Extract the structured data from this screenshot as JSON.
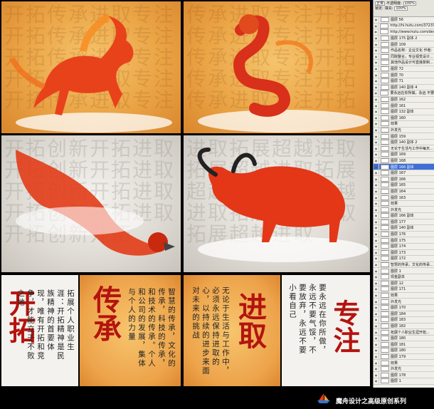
{
  "artworks": [
    {
      "subject": "horse",
      "bg_chars": "开拓传承进取专注开拓传承进取专注开拓传承进取专注开拓传承进取专注开拓传承进取专注"
    },
    {
      "subject": "dragon",
      "bg_chars": "传承进取专注开拓传承进取专注开拓传承进取专注开拓传承进取专注开拓传承进取专注开拓"
    },
    {
      "subject": "eagle",
      "bg_chars": "开拓创新开拓进取开拓创新开拓进取开拓创新开拓进取开拓创新开拓进取开拓创新开拓"
    },
    {
      "subject": "bull",
      "bg_chars": "进取拓展超越进取拓展超越进取拓展超越进取拓展超越进取拓展超越进取拓展超越进取"
    }
  ],
  "posters": [
    {
      "title": "开拓",
      "text": "拓展个人职业生涯：开拓精神是民族精神的首要体现，唯有开拓和竞争，才能立于不败之地"
    },
    {
      "title": "传承",
      "text": "智慧的传承，文化的传承，科技的传承，和技术的传承。个人和公司的发展，集体与个人的力量"
    },
    {
      "title": "进取",
      "text": "无论于生活与工作中，必须永远保持进取的心，以持续的进步来面对未来的挑战"
    },
    {
      "title": "专注",
      "text": "要永远在你所做，永远不要气馁，不要放弃，永远不要小看自己"
    }
  ],
  "layers_panel": {
    "blend_mode": "正常",
    "opacity_label": "不透明度:",
    "opacity_value": "100%",
    "fill_label": "填充:",
    "fill_value": "100%",
    "lock_label": "锁定:",
    "layers": [
      {
        "name": "图层 56",
        "visible": true
      },
      {
        "name": "http://hi.hutu.com/37237...",
        "visible": true
      },
      {
        "name": "http://www.hutu.com/des...",
        "visible": true
      },
      {
        "name": "图层 175 副本 2",
        "visible": true
      },
      {
        "name": "图层 109",
        "visible": true
      },
      {
        "name": "作品名称：企业文化 作者：",
        "visible": true
      },
      {
        "name": "同院整合，专业视觉设计...",
        "visible": true
      },
      {
        "name": "其他作品设计可直接复制...",
        "visible": true
      },
      {
        "name": "图层 72",
        "visible": true
      },
      {
        "name": "图层 70",
        "visible": true
      },
      {
        "name": "图层 71",
        "visible": true
      },
      {
        "name": "图层 140 副本 4",
        "visible": true
      },
      {
        "name": "要永远在你所做，永远 不要...",
        "visible": true
      },
      {
        "name": "图层 162",
        "visible": true
      },
      {
        "name": "图层 161",
        "visible": true
      },
      {
        "name": "图层 132 副本",
        "visible": true
      },
      {
        "name": "图层 160",
        "visible": true
      },
      {
        "name": "效果",
        "visible": true
      },
      {
        "name": "外发光",
        "visible": true
      },
      {
        "name": "图层 159",
        "visible": true
      },
      {
        "name": "图层 140 副本 2",
        "visible": true
      },
      {
        "name": "无论于生活与工作中每天...",
        "visible": true
      },
      {
        "name": "图层 169",
        "visible": true
      },
      {
        "name": "图层 168",
        "visible": true
      },
      {
        "name": "图层 166 副本",
        "visible": true,
        "selected": true
      },
      {
        "name": "图层 167",
        "visible": true
      },
      {
        "name": "图层 166",
        "visible": true
      },
      {
        "name": "图层 165",
        "visible": true
      },
      {
        "name": "图层 164",
        "visible": true
      },
      {
        "name": "图层 163",
        "visible": true
      },
      {
        "name": "效果",
        "visible": true
      },
      {
        "name": "外发光",
        "visible": true
      },
      {
        "name": "图层 166 副本",
        "visible": true
      },
      {
        "name": "图层 177",
        "visible": true
      },
      {
        "name": "图层 140 副本",
        "visible": true
      },
      {
        "name": "图层 176",
        "visible": true
      },
      {
        "name": "图层 175",
        "visible": true
      },
      {
        "name": "图层 174",
        "visible": true
      },
      {
        "name": "图层 173",
        "visible": true
      },
      {
        "name": "图层 172",
        "visible": true
      },
      {
        "name": "智慧的传承，文化的传承...",
        "visible": true
      },
      {
        "name": "图层 1",
        "visible": true
      },
      {
        "name": "现金副本",
        "visible": true
      },
      {
        "name": "图层 12",
        "visible": true
      },
      {
        "name": "图层 171",
        "visible": true
      },
      {
        "name": "效果",
        "visible": true
      },
      {
        "name": "外发光",
        "visible": true
      },
      {
        "name": "图层 170",
        "visible": true
      },
      {
        "name": "图层 184",
        "visible": true
      },
      {
        "name": "图层 183",
        "visible": true
      },
      {
        "name": "图层 182",
        "visible": true
      },
      {
        "name": "拓展个人职业生涯开拓...",
        "visible": true
      },
      {
        "name": "图层 180",
        "visible": true
      },
      {
        "name": "图层 181",
        "visible": true
      },
      {
        "name": "图层 180",
        "visible": true
      },
      {
        "name": "图层 179",
        "visible": true
      },
      {
        "name": "效果",
        "visible": true
      },
      {
        "name": "外发光",
        "visible": true
      },
      {
        "name": "图层 178",
        "visible": true
      },
      {
        "name": "图层 1",
        "visible": true
      }
    ]
  },
  "footer": {
    "text": "魔舟设计之高级原创系列"
  },
  "colors": {
    "title_red": "#b3140f",
    "selected_layer": "#3d6fd6",
    "footer_bg": "#000000"
  }
}
